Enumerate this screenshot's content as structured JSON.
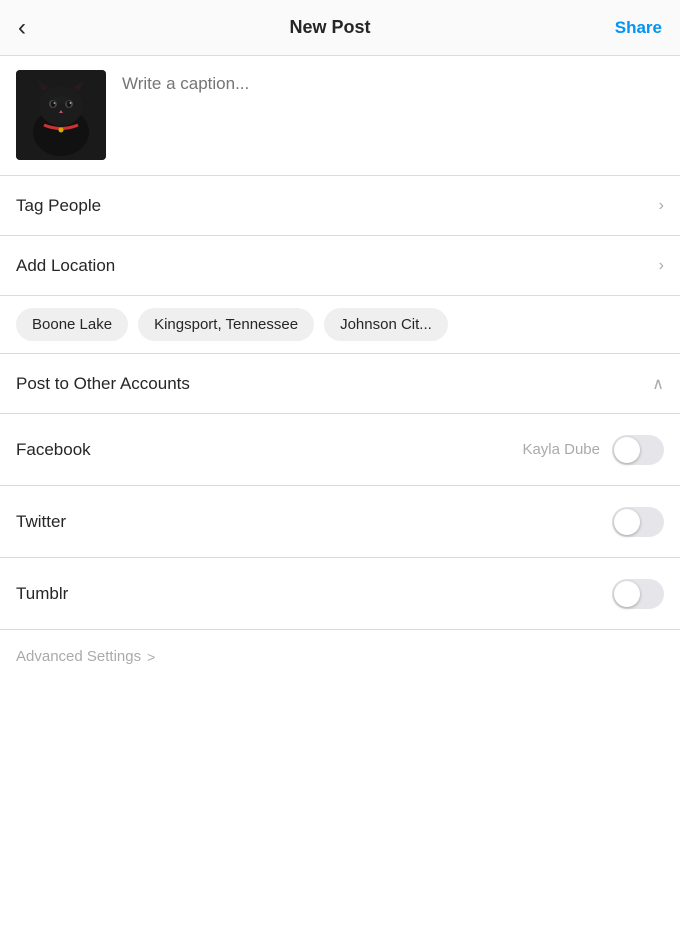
{
  "header": {
    "back_label": "<",
    "title": "New Post",
    "share_label": "Share"
  },
  "caption": {
    "placeholder": "Write a caption..."
  },
  "tag_people": {
    "label": "Tag People"
  },
  "add_location": {
    "label": "Add Location"
  },
  "location_chips": [
    "Boone Lake",
    "Kingsport, Tennessee",
    "Johnson Cit..."
  ],
  "post_to_other": {
    "label": "Post to Other Accounts"
  },
  "social_accounts": [
    {
      "name": "Facebook",
      "account": "Kayla Dube",
      "toggled": false
    },
    {
      "name": "Twitter",
      "account": "",
      "toggled": false
    },
    {
      "name": "Tumblr",
      "account": "",
      "toggled": false
    }
  ],
  "advanced_settings": {
    "label": "Advanced Settings",
    "chevron": ">"
  },
  "icons": {
    "back": "‹",
    "chevron_right": "›",
    "chevron_up": "∧"
  }
}
